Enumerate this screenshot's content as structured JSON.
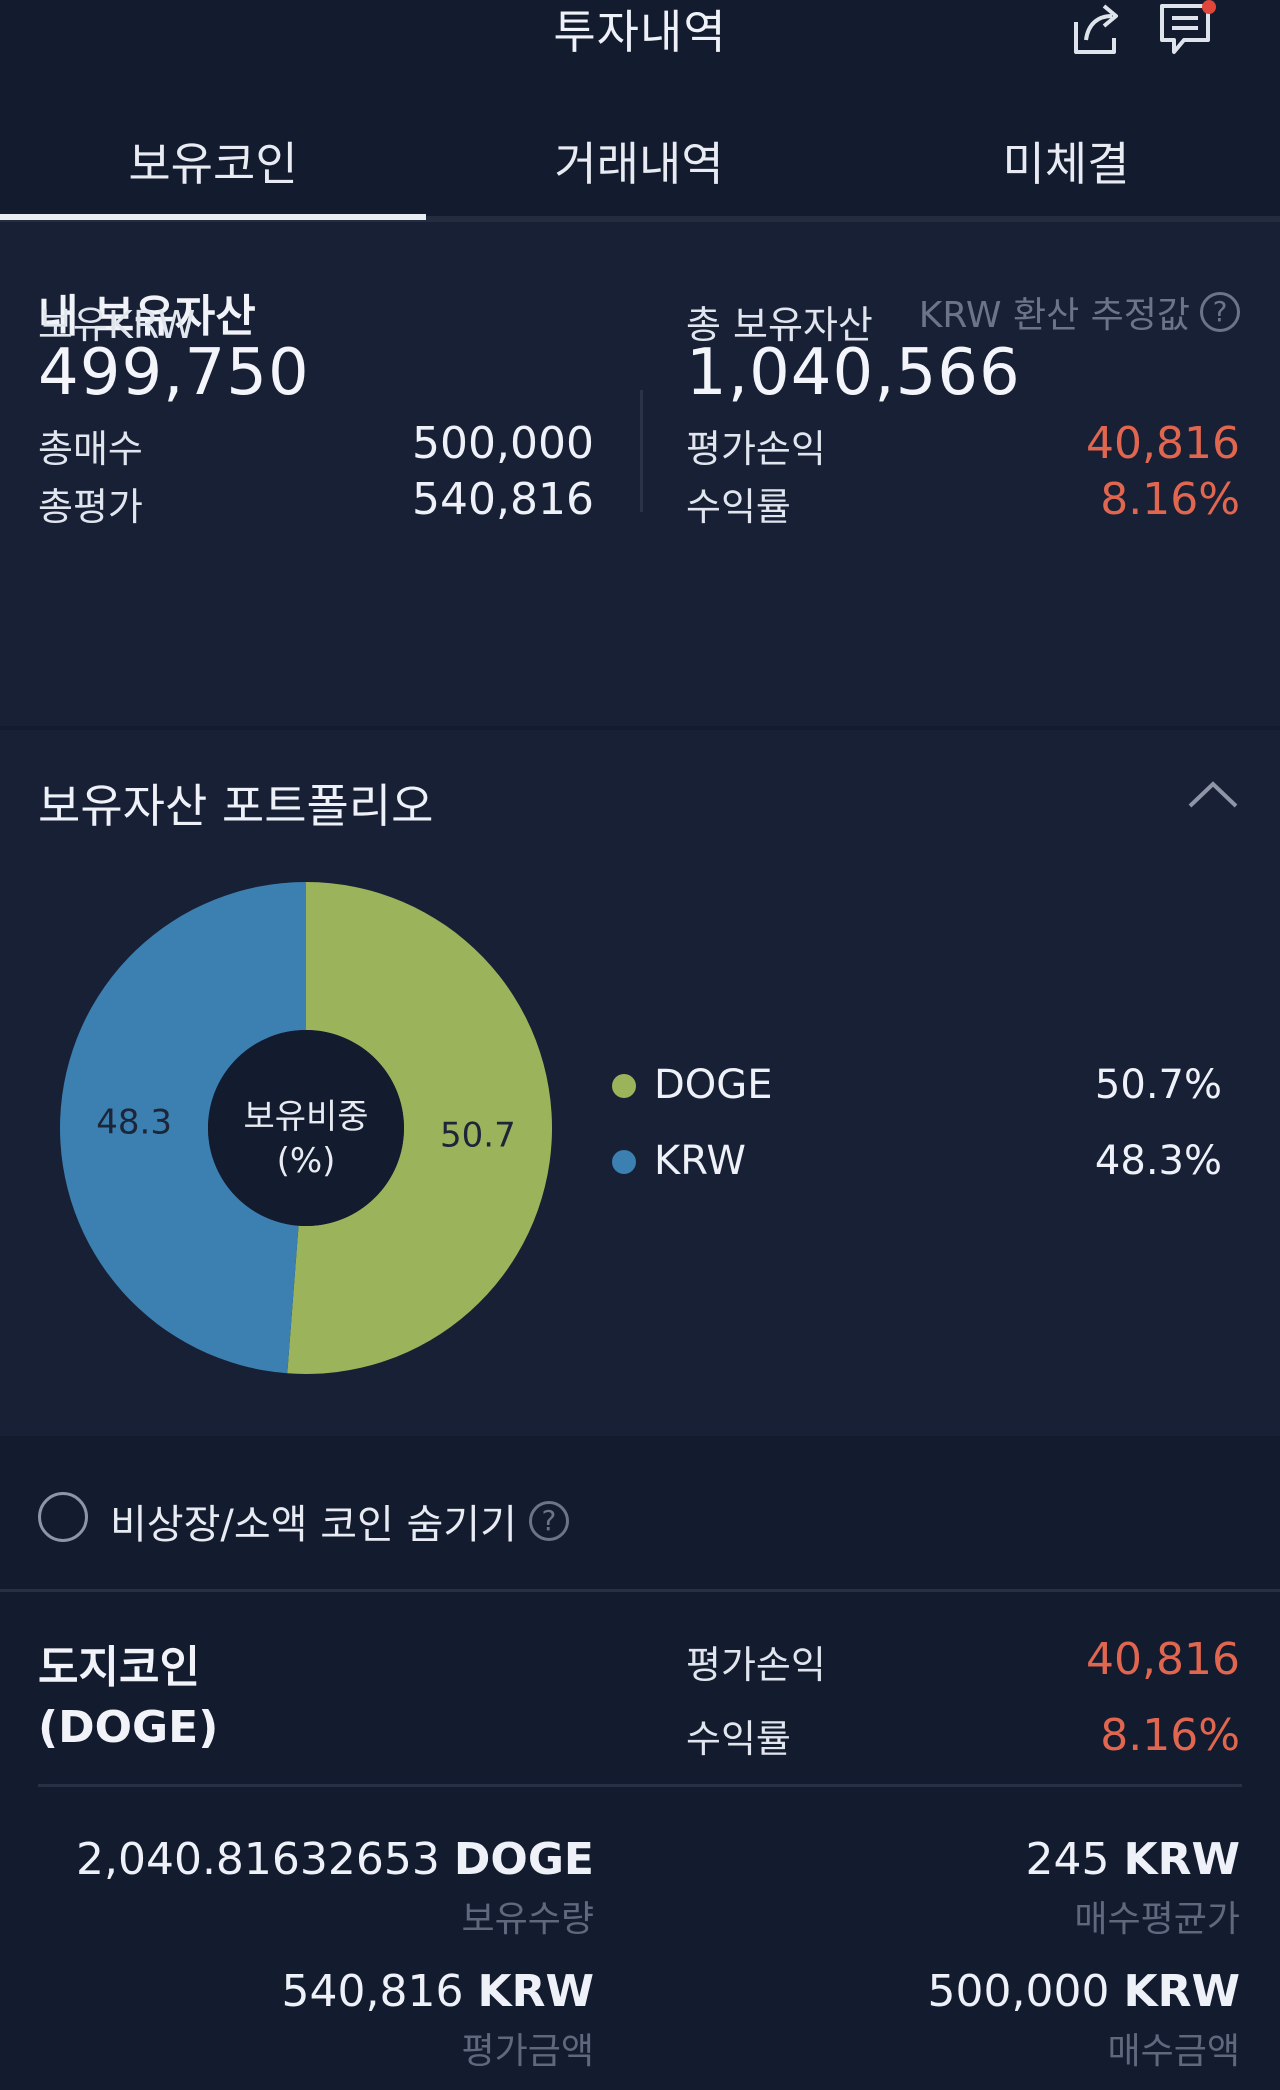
{
  "header": {
    "title": "투자내역",
    "icons": [
      "share-icon",
      "chat-icon"
    ]
  },
  "tabs": [
    {
      "label": "보유코인",
      "active": true
    },
    {
      "label": "거래내역",
      "active": false
    },
    {
      "label": "미체결",
      "active": false
    }
  ],
  "assets": {
    "heading": "내 보유자산",
    "krw_note": "KRW 환산 추정값",
    "held_krw_label": "보유KRW",
    "held_krw_value": "499,750",
    "total_assets_label": "총 보유자산",
    "total_assets_value": "1,040,566",
    "total_buy_label": "총매수",
    "total_buy_value": "500,000",
    "total_eval_label": "총평가",
    "total_eval_value": "540,816",
    "pnl_label": "평가손익",
    "pnl_value": "40,816",
    "return_label": "수익률",
    "return_value": "8.16%"
  },
  "portfolio": {
    "heading": "보유자산 포트폴리오",
    "center_line1": "보유비중",
    "center_line2": "(%)",
    "legend": [
      {
        "name": "DOGE",
        "pct": "50.7%"
      },
      {
        "name": "KRW",
        "pct": "48.3%"
      }
    ]
  },
  "chart_data": {
    "type": "pie",
    "categories": [
      "DOGE",
      "KRW"
    ],
    "values": [
      50.7,
      48.3
    ],
    "data_labels": [
      "50.7",
      "48.3"
    ],
    "colors": [
      "#9bb45b",
      "#3c7fb1"
    ],
    "title": "",
    "legend_position": "right"
  },
  "filter": {
    "label": "비상장/소액 코인 숨기기",
    "checked": false
  },
  "coin": {
    "name_line1": "도지코인",
    "name_line2": "(DOGE)",
    "pnl_label": "평가손익",
    "pnl_value": "40,816",
    "return_label": "수익률",
    "return_value": "8.16%",
    "quantity_number": "2,040.81632653",
    "quantity_unit": "DOGE",
    "quantity_label": "보유수량",
    "avg_price_number": "245",
    "avg_price_unit": "KRW",
    "avg_price_label": "매수평균가",
    "eval_amount_number": "540,816",
    "eval_amount_unit": "KRW",
    "eval_amount_label": "평가금액",
    "buy_amount_number": "500,000",
    "buy_amount_unit": "KRW",
    "buy_amount_label": "매수금액"
  },
  "colors": {
    "accent_red": "#e0664f",
    "doge_green": "#9bb45b",
    "krw_blue": "#3c7fb1",
    "background": "#131b2e"
  }
}
